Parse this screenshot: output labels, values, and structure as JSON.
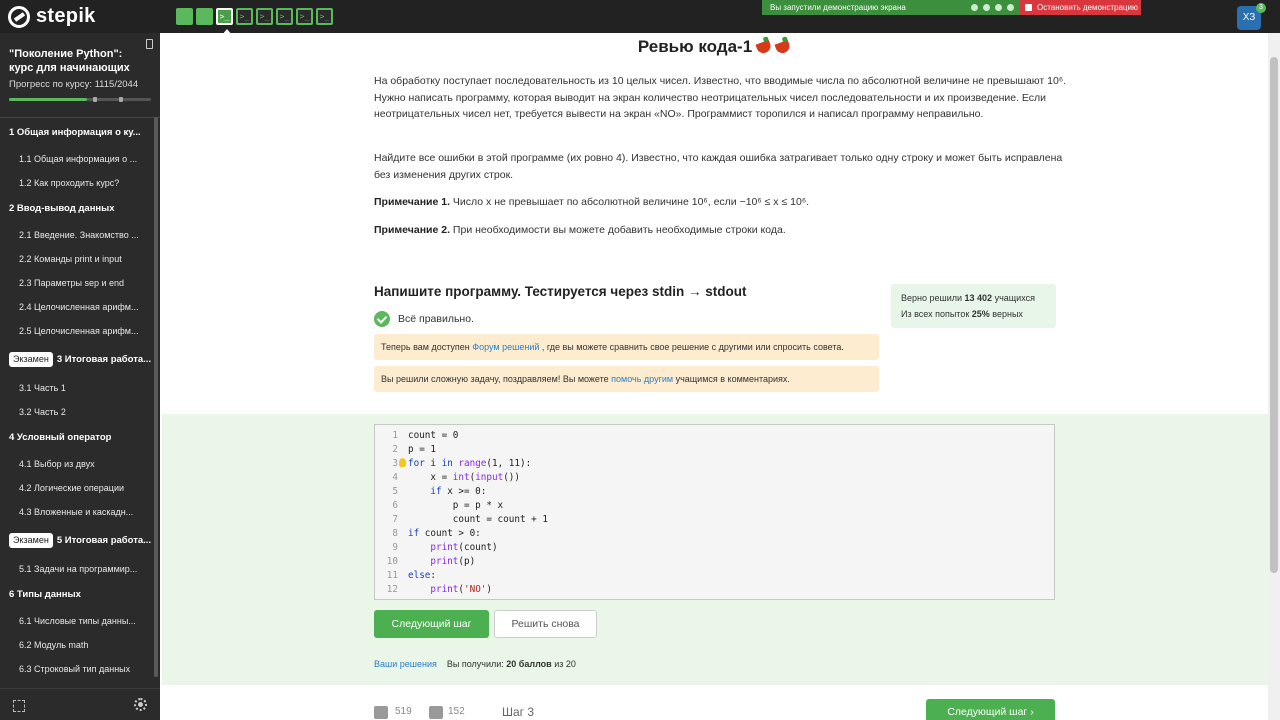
{
  "brand": {
    "name": "stepik"
  },
  "steps_nav": [
    {
      "kind": "text",
      "icon": "step-done-icon"
    },
    {
      "kind": "text",
      "icon": "step-done-icon"
    },
    {
      "kind": "code",
      "glyph": ">_",
      "active": true
    },
    {
      "kind": "code",
      "glyph": ">_"
    },
    {
      "kind": "code",
      "glyph": ">_"
    },
    {
      "kind": "code",
      "glyph": ">_"
    },
    {
      "kind": "code",
      "glyph": ">_"
    },
    {
      "kind": "code",
      "glyph": ">_"
    }
  ],
  "screen_share": {
    "status": "Вы запустили демонстрацию экрана",
    "stop_label": "Остановить демонстрацию"
  },
  "user": {
    "avatar_text": "ХЗ",
    "badge": "3"
  },
  "sidebar": {
    "course_title": "\"Поколение Python\": курс для начинающих",
    "progress_label": "Прогресс по курсу:  1115/2044",
    "progress_value": 0.55,
    "toc": [
      {
        "type": "section",
        "label": "1  Общая информация о ку..."
      },
      {
        "type": "item",
        "label": "1.1  Общая информация о ..."
      },
      {
        "type": "item",
        "label": "1.2  Как проходить курс?"
      },
      {
        "type": "section",
        "label": "2  Ввод-вывод данных"
      },
      {
        "type": "item",
        "label": "2.1  Введение. Знакомство ..."
      },
      {
        "type": "item",
        "label": "2.2  Команды print и input"
      },
      {
        "type": "item",
        "label": "2.3  Параметры sep и end"
      },
      {
        "type": "item",
        "label": "2.4  Целочисленная арифм..."
      },
      {
        "type": "item",
        "label": "2.5  Целочисленная арифм..."
      },
      {
        "type": "section",
        "badge": "Экзамен",
        "label": "3  Итоговая работа..."
      },
      {
        "type": "item",
        "label": "3.1  Часть 1"
      },
      {
        "type": "item",
        "label": "3.2  Часть 2"
      },
      {
        "type": "section",
        "label": "4  Условный оператор"
      },
      {
        "type": "item",
        "label": "4.1  Выбор из двух"
      },
      {
        "type": "item",
        "label": "4.2  Логические операции"
      },
      {
        "type": "item",
        "label": "4.3  Вложенные и каскадн..."
      },
      {
        "type": "section",
        "badge": "Экзамен",
        "label": "5  Итоговая работа..."
      },
      {
        "type": "item",
        "label": "5.1  Задачи на программир..."
      },
      {
        "type": "section",
        "label": "6  Типы данных"
      },
      {
        "type": "item",
        "label": "6.1  Числовые типы данны..."
      },
      {
        "type": "item",
        "label": "6.2  Модуль math"
      },
      {
        "type": "item",
        "label": "6.3  Строковый тип данных"
      }
    ]
  },
  "lesson": {
    "title": "Ревью кода-1",
    "para1": "На обработку поступает последовательность из 10 целых чисел. Известно, что вводимые числа по абсолютной величине не превышают 10⁶. Нужно написать программу, которая выводит на экран количество неотрицательных чисел последовательности и их произведение. Если неотрицательных чисел нет, требуется вывести на экран «NO». Программист торопился и написал программу неправильно.",
    "para2": "Найдите все ошибки в этой программе (их ровно 4). Известно, что каждая ошибка затрагивает только одну строку и может быть исправлена без изменения других строк.",
    "note1_label": "Примечание 1.",
    "note1_text": " Число x не превышает по абсолютной величине 10⁶, если −10⁶ ≤ x ≤ 10⁶.",
    "note2_label": "Примечание 2.",
    "note2_text": " При необходимости вы можете добавить необходимые строки кода."
  },
  "task": {
    "header": "Напишите программу. Тестируется через stdin → stdout",
    "stats_solved_prefix": "Верно решили ",
    "stats_solved_count": "13 402",
    "stats_solved_suffix": " учащихся",
    "stats_attempts_prefix": "Из всех попыток ",
    "stats_attempts_pct": "25%",
    "stats_attempts_suffix": " верных",
    "correct_text": "Всё правильно.",
    "notice1_before": "Теперь вам доступен ",
    "notice1_link": "Форум решений",
    "notice1_after": " , где вы можете сравнить свое решение с другими или спросить совета.",
    "notice2_before": "Вы решили сложную задачу, поздравляем! Вы можете ",
    "notice2_link": "помочь другим",
    "notice2_after": " учащимся в комментариях."
  },
  "code": {
    "lines": [
      "count = 0",
      "p = 1",
      "for i in range(1, 11):",
      "    x = int(input())",
      "    if x >= 0:",
      "        p = p * x",
      "        count = count + 1",
      "if count > 0:",
      "    print(count)",
      "    print(p)",
      "else:",
      "    print('NO')"
    ],
    "hint_line": 3
  },
  "actions": {
    "next_step": "Следующий шаг",
    "retry": "Решить снова",
    "your_solutions": "Ваши решения",
    "score_prefix": "Вы получили: ",
    "score_value": "20 баллов",
    "score_suffix": " из 20"
  },
  "footer": {
    "likes": "519",
    "dislikes": "152",
    "step_label": "Шаг 3",
    "next_label": "Следующий шаг"
  }
}
